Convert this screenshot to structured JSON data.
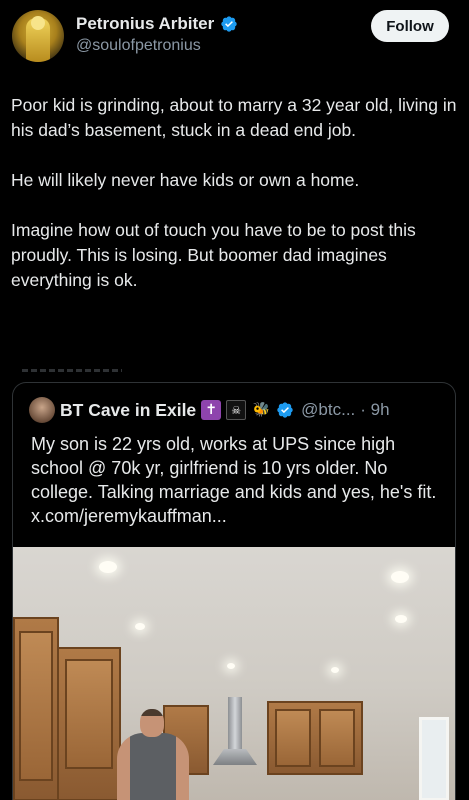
{
  "author": {
    "name": "Petronius Arbiter",
    "handle": "@soulofpetronius",
    "verified": true,
    "follow_label": "Follow"
  },
  "tweet": {
    "paragraphs": [
      "Poor kid is grinding, about to marry a 32 year old, living in his dad’s basement, stuck in a dead end job.",
      "He will likely never have kids or own a home.",
      "Imagine how out of touch you have to be to post this proudly. This is losing. But boomer dad imagines everything is ok."
    ]
  },
  "quote": {
    "name": "BT Cave in Exile",
    "name_emojis": [
      "✝",
      "☠",
      "🐝"
    ],
    "handle": "@btc...",
    "time": "· 9h",
    "text": "My son is 22 yrs old, works at UPS since high school @ 70k yr, girlfriend is 10 yrs older. No college. Talking marriage and kids and yes, he's fit. x.com/jeremykauffman...",
    "media": "kitchen-photo"
  },
  "colors": {
    "background": "#000000",
    "text": "#e7e9ea",
    "secondary": "#8b98a5",
    "verified": "#1d9bf0",
    "border": "#2f3336"
  }
}
